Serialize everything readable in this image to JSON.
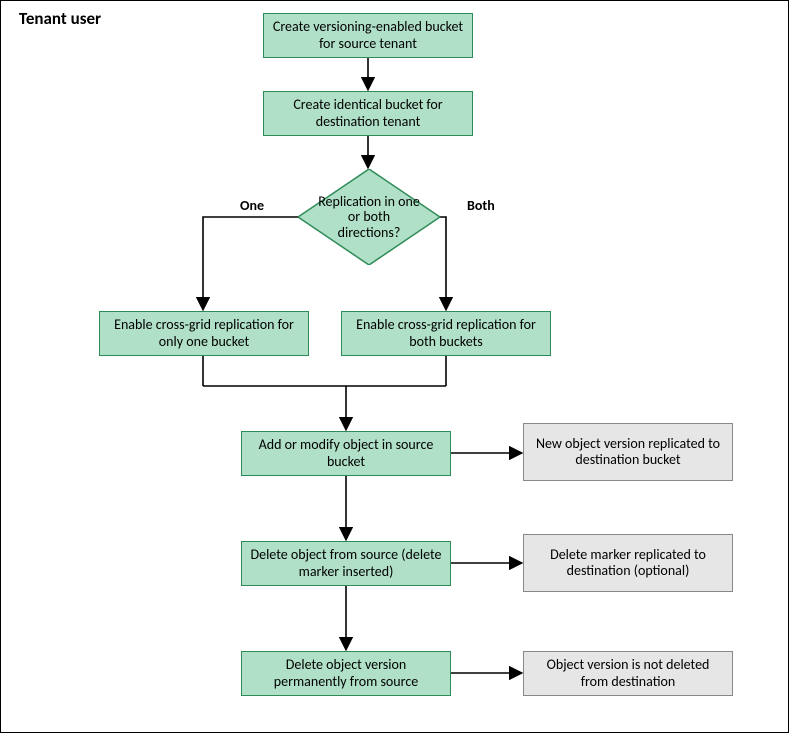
{
  "title": "Tenant user",
  "steps": {
    "create_source": "Create versioning-enabled bucket for source tenant",
    "create_dest": "Create identical bucket for destination tenant",
    "decision": "Replication in one or both directions?",
    "branch_one_label": "One",
    "branch_both_label": "Both",
    "enable_one": "Enable cross-grid replication for only one bucket",
    "enable_both": "Enable cross-grid replication for both buckets",
    "add_modify": "Add or modify object in source bucket",
    "delete_marker": "Delete object from source (delete marker inserted)",
    "delete_perm": "Delete object version permanently from source"
  },
  "results": {
    "new_version": "New object version replicated to destination bucket",
    "delete_marker_result": "Delete marker replicated to destination (optional)",
    "not_deleted": "Object version is not deleted from destination"
  }
}
